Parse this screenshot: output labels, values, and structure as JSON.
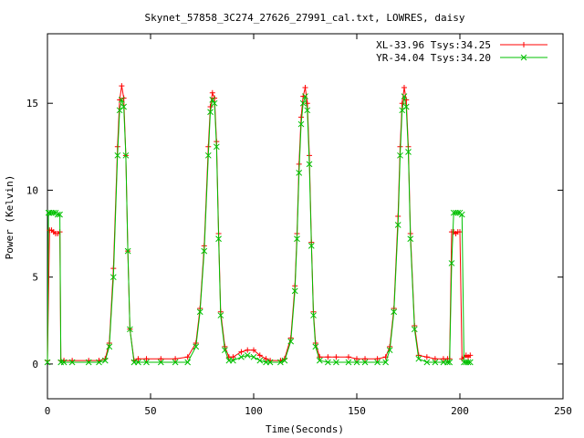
{
  "chart_data": {
    "type": "line",
    "title": "Skynet_57858_3C274_27626_27991_cal.txt, LOWRES, daisy",
    "xlabel": "Time(Seconds)",
    "ylabel": "Power (Kelvin)",
    "xlim": [
      0,
      250
    ],
    "ylim": [
      -2,
      19
    ],
    "xticks": [
      0,
      50,
      100,
      150,
      200,
      250
    ],
    "yticks": [
      0,
      5,
      10,
      15
    ],
    "grid": false,
    "legend_position": "top-right",
    "series": [
      {
        "name": "XL-33.96 Tsys:34.25",
        "color": "#ff0000",
        "marker": "+",
        "x": [
          0,
          1,
          2,
          3,
          4,
          5,
          6,
          6.5,
          8,
          12,
          20,
          25,
          28,
          30,
          32,
          34,
          35,
          36,
          37,
          38,
          39,
          40,
          42,
          44,
          48,
          55,
          62,
          68,
          72,
          74,
          76,
          78,
          79,
          80,
          81,
          82,
          83,
          84,
          86,
          88,
          90,
          94,
          97,
          100,
          103,
          106,
          108,
          113,
          115,
          118,
          120,
          121,
          122,
          123,
          124,
          125,
          126,
          127,
          128,
          129,
          130,
          132,
          136,
          140,
          146,
          150,
          154,
          160,
          164,
          166,
          168,
          170,
          171,
          172,
          173,
          174,
          175,
          176,
          178,
          180,
          184,
          188,
          192,
          194,
          195,
          196,
          197,
          198,
          199,
          200,
          201,
          202,
          203,
          204,
          205
        ],
        "y": [
          0.2,
          7.7,
          7.7,
          7.6,
          7.5,
          7.5,
          7.6,
          0.2,
          0.2,
          0.2,
          0.2,
          0.2,
          0.3,
          1.2,
          5.5,
          12.5,
          15.2,
          16.0,
          15.3,
          12.0,
          6.5,
          2.0,
          0.2,
          0.3,
          0.3,
          0.3,
          0.3,
          0.4,
          1.2,
          3.2,
          6.8,
          12.5,
          14.8,
          15.6,
          15.3,
          12.8,
          7.5,
          3.0,
          1.0,
          0.4,
          0.4,
          0.7,
          0.8,
          0.8,
          0.5,
          0.3,
          0.2,
          0.2,
          0.3,
          1.5,
          4.5,
          7.5,
          11.5,
          14.2,
          15.4,
          15.9,
          15.0,
          12.0,
          7.0,
          3.0,
          1.2,
          0.4,
          0.4,
          0.4,
          0.4,
          0.3,
          0.3,
          0.3,
          0.4,
          1.0,
          3.2,
          8.5,
          12.5,
          15.0,
          15.9,
          15.2,
          12.5,
          7.5,
          2.2,
          0.5,
          0.4,
          0.3,
          0.3,
          0.3,
          0.3,
          7.6,
          7.6,
          7.5,
          7.6,
          7.6,
          0.3,
          0.4,
          0.5,
          0.4,
          0.5
        ]
      },
      {
        "name": "YR-34.04 Tsys:34.20",
        "color": "#00c000",
        "marker": "x",
        "x": [
          0,
          0.5,
          1,
          2,
          3,
          4,
          5,
          6,
          6.5,
          8,
          12,
          20,
          25,
          28,
          30,
          32,
          34,
          35,
          36,
          37,
          38,
          39,
          40,
          42,
          44,
          48,
          55,
          62,
          68,
          72,
          74,
          76,
          78,
          79,
          80,
          81,
          82,
          83,
          84,
          86,
          88,
          90,
          94,
          97,
          100,
          103,
          106,
          108,
          113,
          115,
          118,
          120,
          121,
          122,
          123,
          124,
          125,
          126,
          127,
          128,
          129,
          130,
          132,
          136,
          140,
          146,
          150,
          154,
          160,
          164,
          166,
          168,
          170,
          171,
          172,
          173,
          174,
          175,
          176,
          178,
          180,
          184,
          188,
          192,
          194,
          195,
          196,
          197,
          198,
          199,
          200,
          201,
          202,
          203,
          204,
          205
        ],
        "y": [
          0.1,
          8.7,
          8.7,
          8.7,
          8.7,
          8.7,
          8.6,
          8.6,
          0.1,
          0.1,
          0.1,
          0.1,
          0.1,
          0.2,
          1.0,
          5.0,
          12.0,
          14.6,
          15.2,
          14.8,
          12.0,
          6.5,
          2.0,
          0.1,
          0.1,
          0.1,
          0.1,
          0.1,
          0.1,
          1.0,
          3.0,
          6.5,
          12.0,
          14.5,
          15.2,
          15.0,
          12.5,
          7.2,
          2.8,
          0.8,
          0.2,
          0.2,
          0.4,
          0.5,
          0.4,
          0.2,
          0.1,
          0.1,
          0.1,
          0.2,
          1.3,
          4.2,
          7.2,
          11.0,
          13.8,
          15.0,
          15.4,
          14.6,
          11.5,
          6.8,
          2.8,
          1.0,
          0.2,
          0.1,
          0.1,
          0.1,
          0.1,
          0.1,
          0.1,
          0.1,
          0.8,
          3.0,
          8.0,
          12.0,
          14.6,
          15.4,
          14.8,
          12.2,
          7.2,
          2.0,
          0.3,
          0.1,
          0.1,
          0.1,
          0.1,
          0.1,
          5.8,
          8.7,
          8.7,
          8.7,
          8.7,
          8.6,
          0.1,
          0.1,
          0.1,
          0.1
        ]
      }
    ]
  }
}
